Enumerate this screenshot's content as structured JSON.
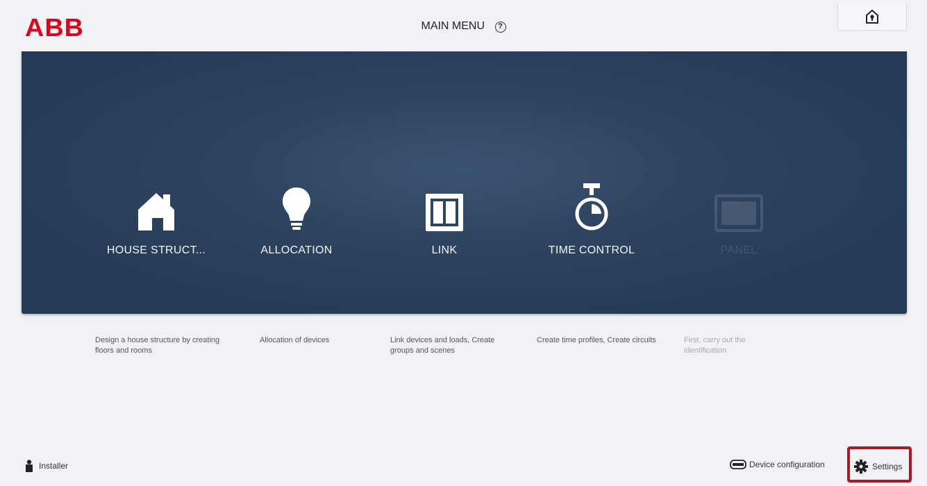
{
  "header": {
    "logo": "ABB",
    "title": "MAIN MENU",
    "help_glyph": "?"
  },
  "tiles": [
    {
      "label": "HOUSE STRUCT...",
      "icon": "house-icon",
      "description": "Design a house structure by creating floors and rooms",
      "enabled": true
    },
    {
      "label": "ALLOCATION",
      "icon": "lightbulb-icon",
      "description": "Allocation of devices",
      "enabled": true
    },
    {
      "label": "LINK",
      "icon": "switch-icon",
      "description": "Link devices and loads, Create groups and scenes",
      "enabled": true
    },
    {
      "label": "TIME CONTROL",
      "icon": "stopwatch-icon",
      "description": "Create time profiles, Create circuits",
      "enabled": true
    },
    {
      "label": "PANEL",
      "icon": "panel-icon",
      "description": "First, carry out the identification",
      "enabled": false
    }
  ],
  "footer": {
    "user_label": "Installer",
    "device_config_label": "Device configuration",
    "settings_label": "Settings"
  },
  "colors": {
    "brand": "#e2001a",
    "panel": "#2e4562",
    "highlight": "#b3141f"
  }
}
